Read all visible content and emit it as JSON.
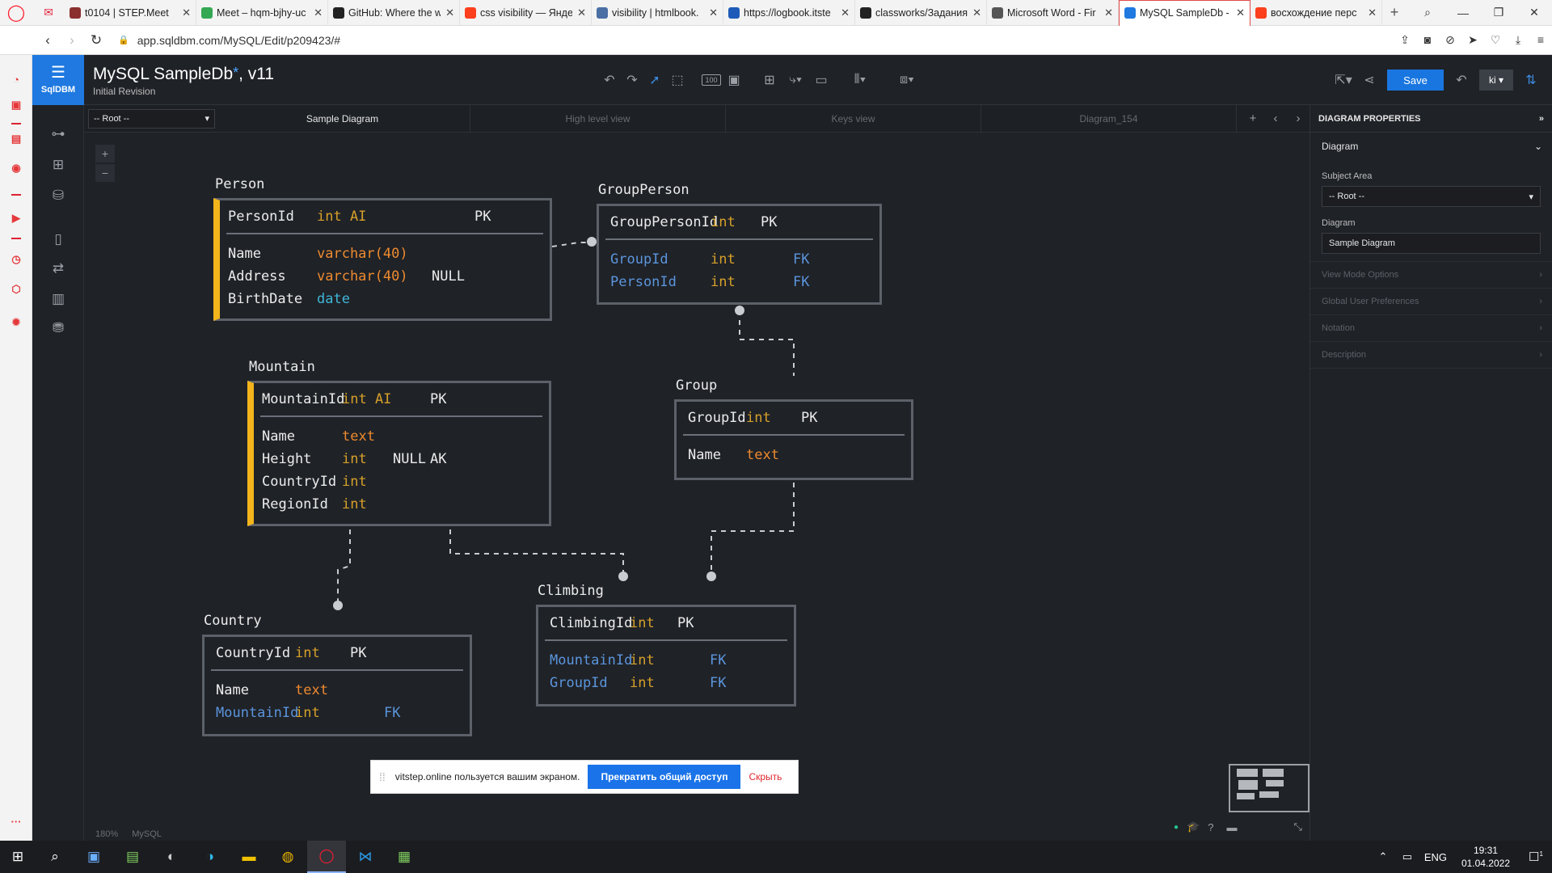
{
  "browser": {
    "tabs": [
      {
        "label": "t0104 | STEP.Meet",
        "favicon": "step-meet-icon"
      },
      {
        "label": "Meet – hqm-bjhy-uc",
        "favicon": "google-meet-icon"
      },
      {
        "label": "GitHub: Where the w",
        "favicon": "github-icon"
      },
      {
        "label": "css visibility — Янде",
        "favicon": "yandex-icon"
      },
      {
        "label": "visibility | htmlbook.",
        "favicon": "htmlbook-icon"
      },
      {
        "label": "https://logbook.itste",
        "favicon": "logbook-icon"
      },
      {
        "label": "classworks/Задания",
        "favicon": "github-icon"
      },
      {
        "label": "Microsoft Word - Fir",
        "favicon": "globe-icon"
      },
      {
        "label": "MySQL SampleDb -",
        "favicon": "sqldbm-icon",
        "active": true
      },
      {
        "label": "восхождение перс",
        "favicon": "yandex-icon"
      }
    ],
    "url": "app.sqldbm.com/MySQL/Edit/p209423/#"
  },
  "app": {
    "brand": "SqlDBM",
    "project_title": "MySQL SampleDb",
    "modified_marker": "*",
    "version": ", v11",
    "revision": "Initial Revision",
    "save_label": "Save",
    "user_label": "ki",
    "zoom_box_label": "100"
  },
  "diagram_tabs": {
    "root_select": "-- Root --",
    "tabs": [
      "Sample Diagram",
      "High level view",
      "Keys view",
      "Diagram_154"
    ],
    "active_index": 0
  },
  "tables": {
    "person": {
      "name": "Person",
      "pk": {
        "col": "PersonId",
        "type": "int AI",
        "key": "PK"
      },
      "rows": [
        {
          "col": "Name",
          "type": "varchar(40)",
          "null": "",
          "key": ""
        },
        {
          "col": "Address",
          "type": "varchar(40)",
          "null": "NULL",
          "key": ""
        },
        {
          "col": "BirthDate",
          "type": "date",
          "null": "",
          "key": ""
        }
      ]
    },
    "groupperson": {
      "name": "GroupPerson",
      "pk": {
        "col": "GroupPersonId",
        "type": "int",
        "key": "PK"
      },
      "rows": [
        {
          "col": "GroupId",
          "type": "int",
          "null": "",
          "key": "FK"
        },
        {
          "col": "PersonId",
          "type": "int",
          "null": "",
          "key": "FK"
        }
      ]
    },
    "mountain": {
      "name": "Mountain",
      "pk": {
        "col": "MountainId",
        "type": "int AI",
        "key": "PK"
      },
      "rows": [
        {
          "col": "Name",
          "type": "text",
          "null": "",
          "key": ""
        },
        {
          "col": "Height",
          "type": "int",
          "null": "NULL",
          "key": "AK"
        },
        {
          "col": "CountryId",
          "type": "int",
          "null": "",
          "key": ""
        },
        {
          "col": "RegionId",
          "type": "int",
          "null": "",
          "key": ""
        }
      ]
    },
    "group": {
      "name": "Group",
      "pk": {
        "col": "GroupId",
        "type": "int",
        "key": "PK"
      },
      "rows": [
        {
          "col": "Name",
          "type": "text",
          "null": "",
          "key": ""
        }
      ]
    },
    "climbing": {
      "name": "Climbing",
      "pk": {
        "col": "ClimbingId",
        "type": "int",
        "key": "PK"
      },
      "rows": [
        {
          "col": "MountainId",
          "type": "int",
          "null": "",
          "key": "FK"
        },
        {
          "col": "GroupId",
          "type": "int",
          "null": "",
          "key": "FK"
        }
      ]
    },
    "country": {
      "name": "Country",
      "pk": {
        "col": "CountryId",
        "type": "int",
        "key": "PK"
      },
      "rows": [
        {
          "col": "Name",
          "type": "text",
          "null": "",
          "key": ""
        },
        {
          "col": "MountainId",
          "type": "int",
          "null": "",
          "key": "FK"
        }
      ]
    }
  },
  "share_banner": {
    "text": "vitstep.online пользуется вашим экраном.",
    "stop_label": "Прекратить общий доступ",
    "hide_label": "Скрыть"
  },
  "footer": {
    "zoom": "180%",
    "db": "MySQL"
  },
  "properties": {
    "header": "DIAGRAM PROPERTIES",
    "section": "Diagram",
    "subject_area_label": "Subject Area",
    "subject_area_value": "-- Root --",
    "diagram_label": "Diagram",
    "diagram_value": "Sample Diagram",
    "collapsed": [
      "View Mode Options",
      "Global User Preferences",
      "Notation",
      "Description"
    ]
  },
  "taskbar": {
    "lang": "ENG",
    "time": "19:31",
    "date": "01.04.2022",
    "notifications": "1"
  },
  "colors": {
    "accent_blue": "#1976e0",
    "pk_accent": "#f3b51b",
    "fk_text": "#5b95dd",
    "type_text": "#d6a02a"
  }
}
